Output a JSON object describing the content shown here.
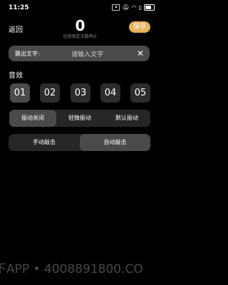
{
  "status_bar": {
    "time": "11:25",
    "icons": [
      "notification-icon",
      "mute-icon",
      "wifi-icon",
      "sim-icon",
      "battery-icon"
    ]
  },
  "header": {
    "back_label": "返回",
    "counter_value": "0",
    "counter_subtitle": "达到指定次数停止",
    "save_label": "保存",
    "save_color": "#e8b25c"
  },
  "text_input": {
    "label": "飘出文字:",
    "placeholder": "请输入文字"
  },
  "sound": {
    "title": "音效",
    "options": [
      "01",
      "02",
      "03",
      "04",
      "05"
    ],
    "selected_index": 0
  },
  "vibration": {
    "options": [
      "振动关闭",
      "轻微振动",
      "默认振动"
    ],
    "selected_index": 0
  },
  "mode": {
    "options": [
      "手动敲击",
      "自动敲击"
    ],
    "selected_index": 1
  },
  "watermark": "下APP • 4008891800.CO"
}
